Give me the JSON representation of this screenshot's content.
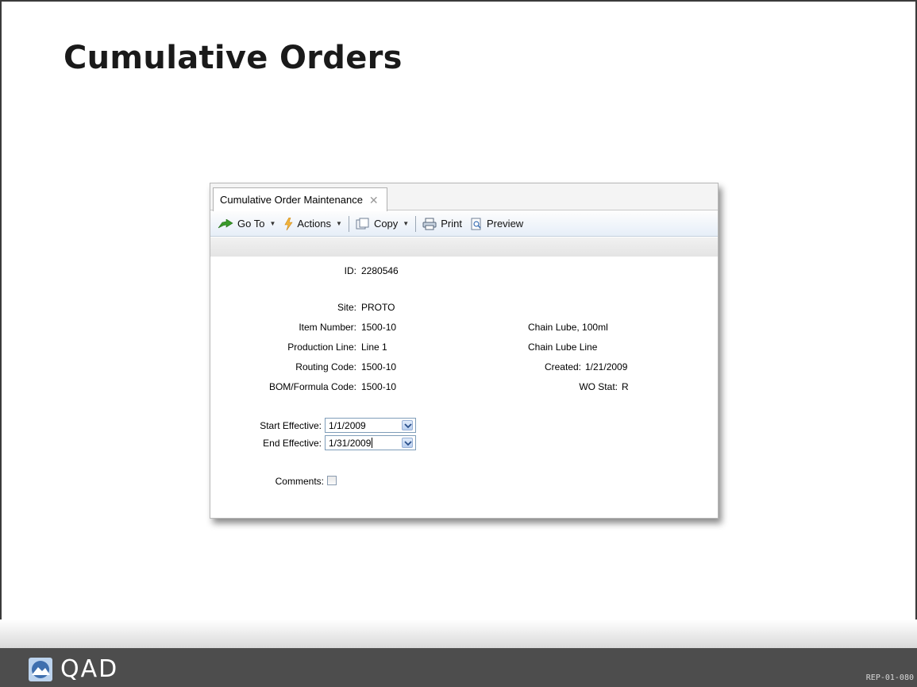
{
  "slide": {
    "title": "Cumulative Orders",
    "code": "REP-01-080"
  },
  "window": {
    "tab_label": "Cumulative Order Maintenance",
    "toolbar": {
      "goto_label": "Go To",
      "actions_label": "Actions",
      "copy_label": "Copy",
      "print_label": "Print",
      "preview_label": "Preview"
    },
    "form": {
      "id_label": "ID:",
      "id_value": "2280546",
      "site_label": "Site:",
      "site_value": "PROTO",
      "item_number_label": "Item Number:",
      "item_number_value": "1500-10",
      "item_description": "Chain Lube, 100ml",
      "production_line_label": "Production Line:",
      "production_line_value": "Line 1",
      "production_line_description": "Chain Lube Line",
      "routing_code_label": "Routing Code:",
      "routing_code_value": "1500-10",
      "created_label": "Created:",
      "created_value": "1/21/2009",
      "bom_label": "BOM/Formula Code:",
      "bom_value": "1500-10",
      "wo_stat_label": "WO Stat:",
      "wo_stat_value": "R",
      "start_effective_label": "Start Effective:",
      "start_effective_value": "1/1/2009",
      "end_effective_label": "End Effective:",
      "end_effective_value": "1/31/2009",
      "comments_label": "Comments:",
      "comments_checked": false
    }
  },
  "footer": {
    "brand": "QAD"
  },
  "icons": {
    "goto": "green-arrow-icon",
    "actions": "lightning-icon",
    "copy": "copy-icon",
    "print": "printer-icon",
    "preview": "preview-icon",
    "logo": "qad-logo-icon"
  }
}
